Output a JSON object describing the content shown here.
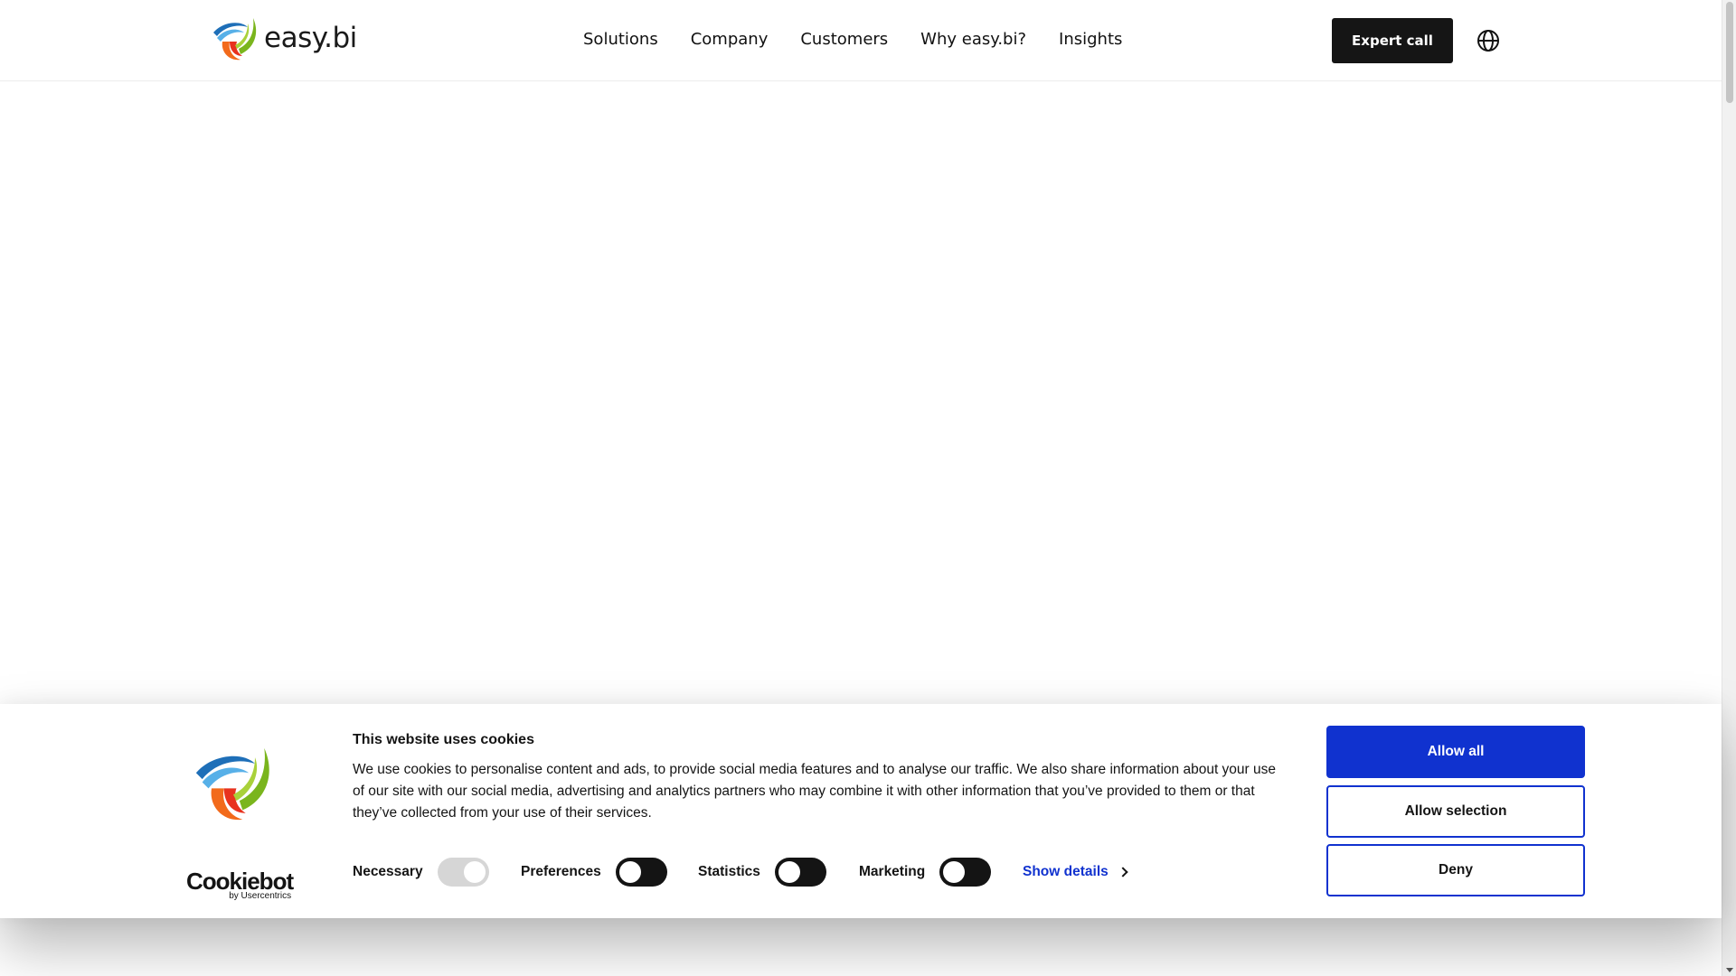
{
  "header": {
    "logo_text": "easy.bi",
    "nav": [
      "Solutions",
      "Company",
      "Customers",
      "Why easy.bi?",
      "Insights"
    ],
    "cta_label": "Expert call",
    "language_icon": "globe-icon"
  },
  "cookie_banner": {
    "title": "This website uses cookies",
    "body": "We use cookies to personalise content and ads, to provide social media features and to analyse our traffic. We also share information about your use of our site with our social media, advertising and analytics partners who may combine it with other information that you’ve provided to them or that they’ve collected from your use of their services.",
    "brand_main": "Cookiebot",
    "brand_sub": "by Usercentrics",
    "consents": [
      {
        "label": "Necessary",
        "checked": true,
        "disabled": true
      },
      {
        "label": "Preferences",
        "checked": false
      },
      {
        "label": "Statistics",
        "checked": false
      },
      {
        "label": "Marketing",
        "checked": false
      }
    ],
    "show_details": "Show details",
    "buttons": {
      "allow_all": "Allow all",
      "allow_selection": "Allow selection",
      "deny": "Deny"
    }
  },
  "colors": {
    "primary_blue": "#1032cf",
    "dark": "#151515",
    "logo_blue": "#1e6fb8",
    "logo_orange": "#f26a1b",
    "logo_green": "#7ab51d"
  }
}
